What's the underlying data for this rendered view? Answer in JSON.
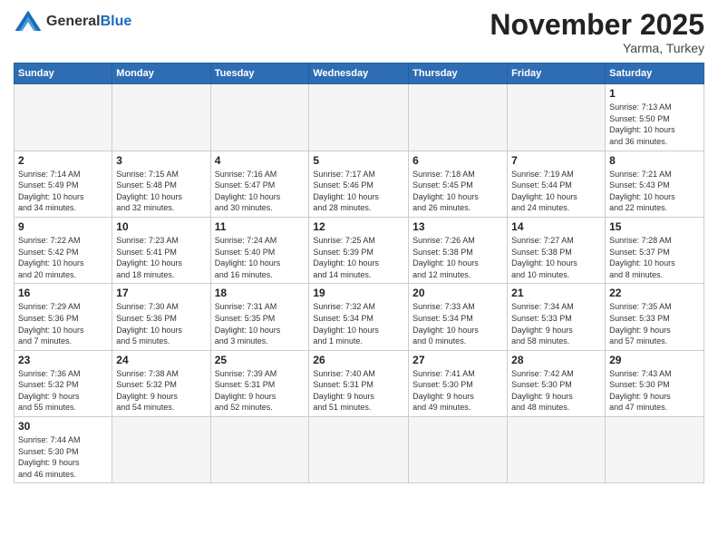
{
  "header": {
    "logo_general": "General",
    "logo_blue": "Blue",
    "month_title": "November 2025",
    "subtitle": "Yarma, Turkey"
  },
  "weekdays": [
    "Sunday",
    "Monday",
    "Tuesday",
    "Wednesday",
    "Thursday",
    "Friday",
    "Saturday"
  ],
  "weeks": [
    [
      {
        "day": "",
        "info": ""
      },
      {
        "day": "",
        "info": ""
      },
      {
        "day": "",
        "info": ""
      },
      {
        "day": "",
        "info": ""
      },
      {
        "day": "",
        "info": ""
      },
      {
        "day": "",
        "info": ""
      },
      {
        "day": "1",
        "info": "Sunrise: 7:13 AM\nSunset: 5:50 PM\nDaylight: 10 hours\nand 36 minutes."
      }
    ],
    [
      {
        "day": "2",
        "info": "Sunrise: 7:14 AM\nSunset: 5:49 PM\nDaylight: 10 hours\nand 34 minutes."
      },
      {
        "day": "3",
        "info": "Sunrise: 7:15 AM\nSunset: 5:48 PM\nDaylight: 10 hours\nand 32 minutes."
      },
      {
        "day": "4",
        "info": "Sunrise: 7:16 AM\nSunset: 5:47 PM\nDaylight: 10 hours\nand 30 minutes."
      },
      {
        "day": "5",
        "info": "Sunrise: 7:17 AM\nSunset: 5:46 PM\nDaylight: 10 hours\nand 28 minutes."
      },
      {
        "day": "6",
        "info": "Sunrise: 7:18 AM\nSunset: 5:45 PM\nDaylight: 10 hours\nand 26 minutes."
      },
      {
        "day": "7",
        "info": "Sunrise: 7:19 AM\nSunset: 5:44 PM\nDaylight: 10 hours\nand 24 minutes."
      },
      {
        "day": "8",
        "info": "Sunrise: 7:21 AM\nSunset: 5:43 PM\nDaylight: 10 hours\nand 22 minutes."
      }
    ],
    [
      {
        "day": "9",
        "info": "Sunrise: 7:22 AM\nSunset: 5:42 PM\nDaylight: 10 hours\nand 20 minutes."
      },
      {
        "day": "10",
        "info": "Sunrise: 7:23 AM\nSunset: 5:41 PM\nDaylight: 10 hours\nand 18 minutes."
      },
      {
        "day": "11",
        "info": "Sunrise: 7:24 AM\nSunset: 5:40 PM\nDaylight: 10 hours\nand 16 minutes."
      },
      {
        "day": "12",
        "info": "Sunrise: 7:25 AM\nSunset: 5:39 PM\nDaylight: 10 hours\nand 14 minutes."
      },
      {
        "day": "13",
        "info": "Sunrise: 7:26 AM\nSunset: 5:38 PM\nDaylight: 10 hours\nand 12 minutes."
      },
      {
        "day": "14",
        "info": "Sunrise: 7:27 AM\nSunset: 5:38 PM\nDaylight: 10 hours\nand 10 minutes."
      },
      {
        "day": "15",
        "info": "Sunrise: 7:28 AM\nSunset: 5:37 PM\nDaylight: 10 hours\nand 8 minutes."
      }
    ],
    [
      {
        "day": "16",
        "info": "Sunrise: 7:29 AM\nSunset: 5:36 PM\nDaylight: 10 hours\nand 7 minutes."
      },
      {
        "day": "17",
        "info": "Sunrise: 7:30 AM\nSunset: 5:36 PM\nDaylight: 10 hours\nand 5 minutes."
      },
      {
        "day": "18",
        "info": "Sunrise: 7:31 AM\nSunset: 5:35 PM\nDaylight: 10 hours\nand 3 minutes."
      },
      {
        "day": "19",
        "info": "Sunrise: 7:32 AM\nSunset: 5:34 PM\nDaylight: 10 hours\nand 1 minute."
      },
      {
        "day": "20",
        "info": "Sunrise: 7:33 AM\nSunset: 5:34 PM\nDaylight: 10 hours\nand 0 minutes."
      },
      {
        "day": "21",
        "info": "Sunrise: 7:34 AM\nSunset: 5:33 PM\nDaylight: 9 hours\nand 58 minutes."
      },
      {
        "day": "22",
        "info": "Sunrise: 7:35 AM\nSunset: 5:33 PM\nDaylight: 9 hours\nand 57 minutes."
      }
    ],
    [
      {
        "day": "23",
        "info": "Sunrise: 7:36 AM\nSunset: 5:32 PM\nDaylight: 9 hours\nand 55 minutes."
      },
      {
        "day": "24",
        "info": "Sunrise: 7:38 AM\nSunset: 5:32 PM\nDaylight: 9 hours\nand 54 minutes."
      },
      {
        "day": "25",
        "info": "Sunrise: 7:39 AM\nSunset: 5:31 PM\nDaylight: 9 hours\nand 52 minutes."
      },
      {
        "day": "26",
        "info": "Sunrise: 7:40 AM\nSunset: 5:31 PM\nDaylight: 9 hours\nand 51 minutes."
      },
      {
        "day": "27",
        "info": "Sunrise: 7:41 AM\nSunset: 5:30 PM\nDaylight: 9 hours\nand 49 minutes."
      },
      {
        "day": "28",
        "info": "Sunrise: 7:42 AM\nSunset: 5:30 PM\nDaylight: 9 hours\nand 48 minutes."
      },
      {
        "day": "29",
        "info": "Sunrise: 7:43 AM\nSunset: 5:30 PM\nDaylight: 9 hours\nand 47 minutes."
      }
    ],
    [
      {
        "day": "30",
        "info": "Sunrise: 7:44 AM\nSunset: 5:30 PM\nDaylight: 9 hours\nand 46 minutes."
      },
      {
        "day": "",
        "info": ""
      },
      {
        "day": "",
        "info": ""
      },
      {
        "day": "",
        "info": ""
      },
      {
        "day": "",
        "info": ""
      },
      {
        "day": "",
        "info": ""
      },
      {
        "day": "",
        "info": ""
      }
    ]
  ]
}
